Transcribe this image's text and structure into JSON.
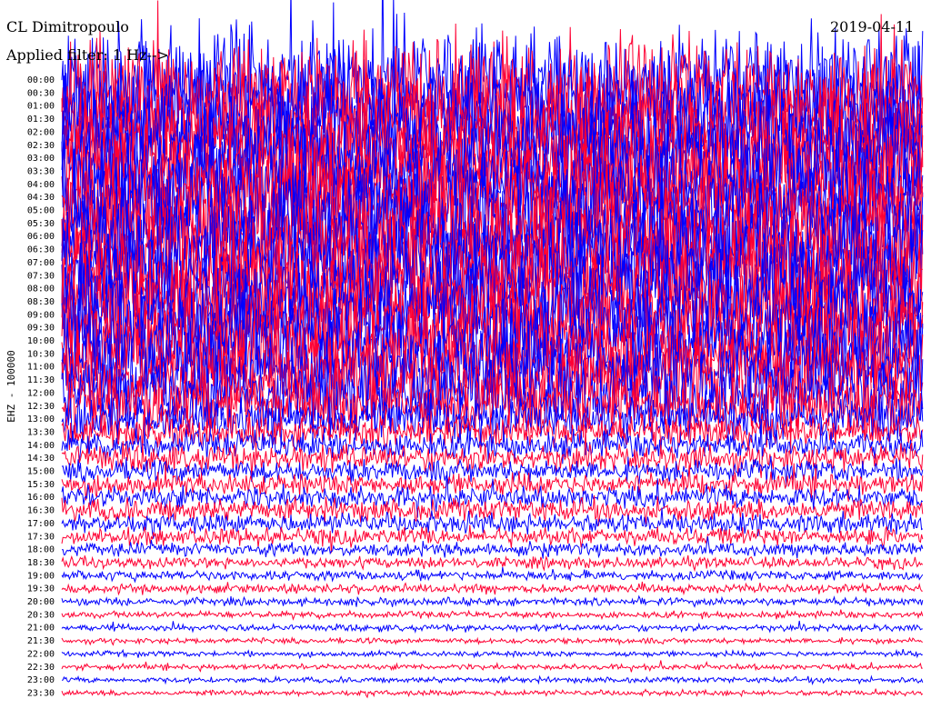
{
  "header": {
    "station": "CL Dimitropoulo",
    "filter_text": "Applied filter: 1 Hz-->",
    "date": "2019-04-11"
  },
  "chart_data": {
    "type": "line",
    "title": "CL Dimitropoulo",
    "subtitle": "Applied filter: 1 Hz-->",
    "xlabel": "",
    "ylabel": "EHZ - 100000",
    "grid": false,
    "rows_per_line": 48,
    "colors": {
      "odd": "#0000ff",
      "even": "#ff0033"
    },
    "time_labels": [
      "00:00",
      "00:30",
      "01:00",
      "01:30",
      "02:00",
      "02:30",
      "03:00",
      "03:30",
      "04:00",
      "04:30",
      "05:00",
      "05:30",
      "06:00",
      "06:30",
      "07:00",
      "07:30",
      "08:00",
      "08:30",
      "09:00",
      "09:30",
      "10:00",
      "10:30",
      "11:00",
      "11:30",
      "12:00",
      "12:30",
      "13:00",
      "13:30",
      "14:00",
      "14:30",
      "15:00",
      "15:30",
      "16:00",
      "16:30",
      "17:00",
      "17:30",
      "18:00",
      "18:30",
      "19:00",
      "19:30",
      "20:00",
      "20:30",
      "21:00",
      "21:30",
      "22:00",
      "22:30",
      "23:00",
      "23:30"
    ],
    "row_amplitude": [
      10,
      10,
      10,
      10,
      10,
      10,
      10,
      10,
      10,
      10,
      10,
      10,
      10,
      10,
      10,
      10,
      10,
      10,
      10,
      9,
      9,
      8,
      8,
      8,
      7,
      6,
      4,
      3,
      2.5,
      2.5,
      2,
      2,
      2,
      2,
      1.8,
      1.6,
      1.2,
      1.0,
      0.9,
      0.8,
      0.7,
      0.6,
      0.6,
      0.5,
      0.5,
      0.5,
      0.5,
      0.5
    ]
  }
}
